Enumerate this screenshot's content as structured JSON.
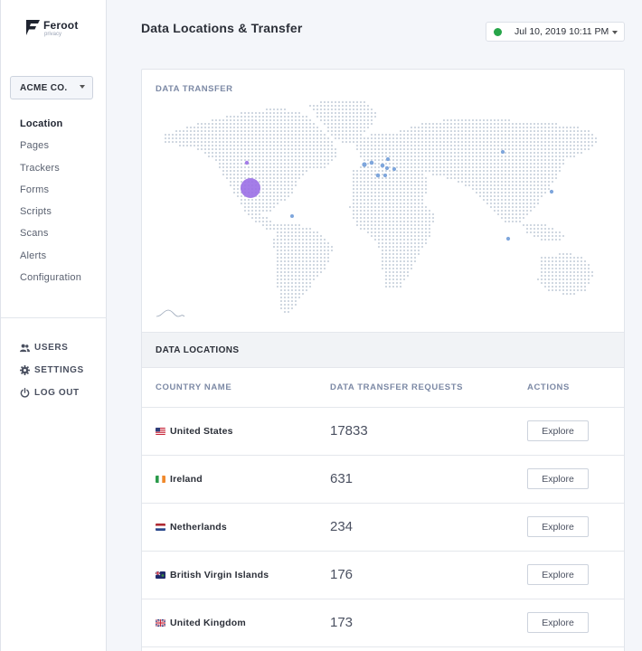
{
  "brand": {
    "name": "Feroot",
    "sub": "privacy"
  },
  "org_select": {
    "value": "ACME CO."
  },
  "nav": [
    {
      "label": "Location",
      "active": true
    },
    {
      "label": "Pages"
    },
    {
      "label": "Trackers"
    },
    {
      "label": "Forms"
    },
    {
      "label": "Scripts"
    },
    {
      "label": "Scans"
    },
    {
      "label": "Alerts"
    },
    {
      "label": "Configuration"
    }
  ],
  "util_nav": [
    {
      "label": "USERS",
      "icon": "users-icon"
    },
    {
      "label": "SETTINGS",
      "icon": "gear-icon"
    },
    {
      "label": "LOG OUT",
      "icon": "power-icon"
    }
  ],
  "header": {
    "title": "Data Locations & Transfer",
    "date": "Jul 10, 2019 10:11 PM",
    "status_color": "#27a549"
  },
  "transfer": {
    "label": "DATA TRANSFER"
  },
  "locations": {
    "label": "DATA LOCATIONS",
    "columns": [
      "COUNTRY NAME",
      "DATA TRANSFER REQUESTS",
      "ACTIONS"
    ],
    "rows": [
      {
        "country": "United States",
        "flag": "us",
        "requests": "17833",
        "action": "Explore"
      },
      {
        "country": "Ireland",
        "flag": "ie",
        "requests": "631",
        "action": "Explore"
      },
      {
        "country": "Netherlands",
        "flag": "nl",
        "requests": "234",
        "action": "Explore"
      },
      {
        "country": "British Virgin Islands",
        "flag": "vg",
        "requests": "176",
        "action": "Explore"
      },
      {
        "country": "United Kingdom",
        "flag": "gb",
        "requests": "173",
        "action": "Explore"
      }
    ]
  },
  "colors": {
    "accent_purple": "#9a6fe6",
    "marker_blue": "#7ea6dc",
    "map_dots": "#a9b7c8"
  }
}
